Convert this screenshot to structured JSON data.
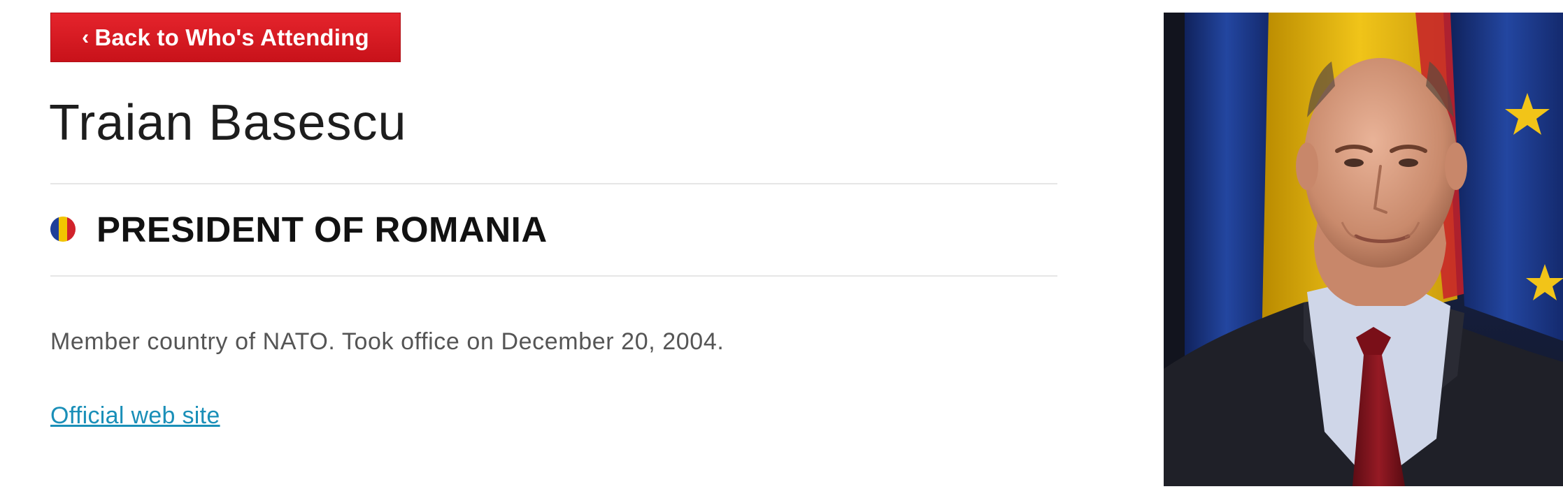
{
  "back_button": {
    "icon": "chevron-left-icon",
    "label": "Back to Who's Attending"
  },
  "person": {
    "name": "Traian Basescu",
    "title": "PRESIDENT OF ROMANIA",
    "flag_icon": "romania-flag-icon",
    "flag_colors": [
      "#1f3f99",
      "#f2c500",
      "#d1222b"
    ],
    "description": "Member country of NATO. Took office on December 20, 2004.",
    "link_label": "Official web site"
  },
  "colors": {
    "button_red": "#d71920",
    "link_blue": "#1a8fb8",
    "divider": "#e6e6e6"
  }
}
